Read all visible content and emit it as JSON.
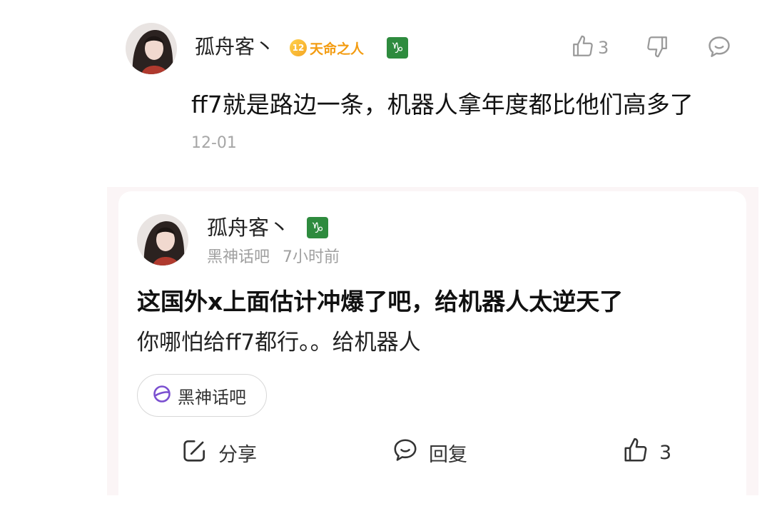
{
  "top_comment": {
    "username": "孤舟客丶",
    "level_number": "12",
    "level_title": "天命之人",
    "zodiac_symbol": "♑",
    "like_count": "3",
    "text": "ff7就是路边一条，机器人拿年度都比他们高多了",
    "date": "12-01"
  },
  "quoted_post": {
    "username": "孤舟客丶",
    "zodiac_symbol": "♑",
    "forum": "黑神话吧",
    "time_ago": "7小时前",
    "title": "这国外x上面估计冲爆了吧，给机器人太逆天了",
    "body": "你哪怕给ff7都行。。给机器人",
    "tag_label": "黑神话吧",
    "actions": {
      "share_label": "分享",
      "reply_label": "回复",
      "like_count": "3"
    }
  },
  "icons": {
    "like": "thumbs-up-icon",
    "dislike": "thumbs-down-icon",
    "reply": "comment-bubble-icon",
    "share": "share-arrow-icon",
    "forum": "forum-planet-icon"
  },
  "colors": {
    "level_badge": "#f5a623",
    "zodiac_badge": "#2e8b3e",
    "forum_icon": "#7a4fd0",
    "card_border": "#fbf5f6"
  }
}
